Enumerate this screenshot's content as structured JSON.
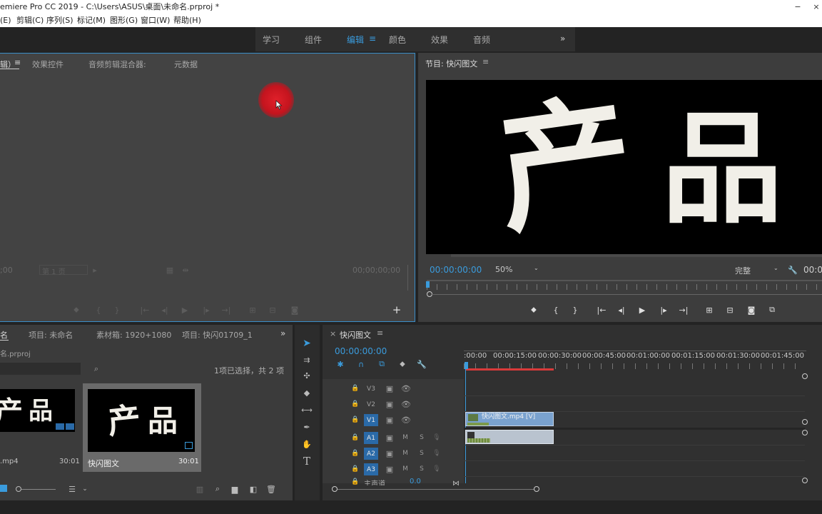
{
  "window": {
    "title": "emiere Pro CC 2019 - C:\\Users\\ASUS\\桌面\\未命名.prproj *",
    "minimize_glyph": "−",
    "close_glyph": "×"
  },
  "menu": [
    "(E)",
    "剪辑(C)",
    "序列(S)",
    "标记(M)",
    "图形(G)",
    "窗口(W)",
    "帮助(H)"
  ],
  "workspaces": {
    "items": [
      "学习",
      "组件",
      "编辑",
      "颜色",
      "效果",
      "音频"
    ],
    "active": "编辑",
    "more": "»"
  },
  "source_panel": {
    "tabs": [
      "辑）",
      "效果控件",
      "音频剪辑混合器:",
      "元数据"
    ],
    "timecode_left": ";00",
    "page_select": "第 1 页",
    "timecode_right": "00;00;00;00"
  },
  "program_panel": {
    "title": "节目: 快闪图文",
    "menu_glyph": "≡",
    "frame_text": [
      "产",
      "品"
    ],
    "timecode": "00:00:00:00",
    "zoom": "50%",
    "quality": "完整",
    "timecode_end": "00:0"
  },
  "project_panel": {
    "tabs": [
      "名",
      "项目: 未命名",
      "素材箱: 1920+1080",
      "项目: 快闪01709_1"
    ],
    "more": "»",
    "file_name": "名.prproj",
    "selection_status": "1项已选择，共 2 项",
    "items": [
      {
        "name": ".mp4",
        "duration": "30:01",
        "frame_text": [
          "产",
          "品"
        ]
      },
      {
        "name": "快闪图文",
        "duration": "30:01",
        "frame_text": [
          "产",
          "品"
        ]
      }
    ]
  },
  "timeline": {
    "close_glyph": "×",
    "title": "快闪图文",
    "menu_glyph": "≡",
    "timecode": "00:00:00:00",
    "ruler": [
      ":00:00",
      "00:00:15:00",
      "00:00:30:00",
      "00:00:45:00",
      "00:01:00:00",
      "00:01:15:00",
      "00:01:30:00",
      "00:01:45:00"
    ],
    "video_tracks": [
      "V3",
      "V2",
      "V1"
    ],
    "audio_tracks": [
      "A1",
      "A2",
      "A3"
    ],
    "mute_label": "M",
    "solo_label": "S",
    "master_label": "主声道",
    "master_value": "0.0",
    "video_clip_label": "快闪图文.mp4 [V]",
    "colors": {
      "accent": "#3a9bdc",
      "track_on": "#2a6aa8",
      "clip_video": "#7aa2cf",
      "clip_audio": "#b9c3cf",
      "work_area": "#d93a3a"
    }
  }
}
